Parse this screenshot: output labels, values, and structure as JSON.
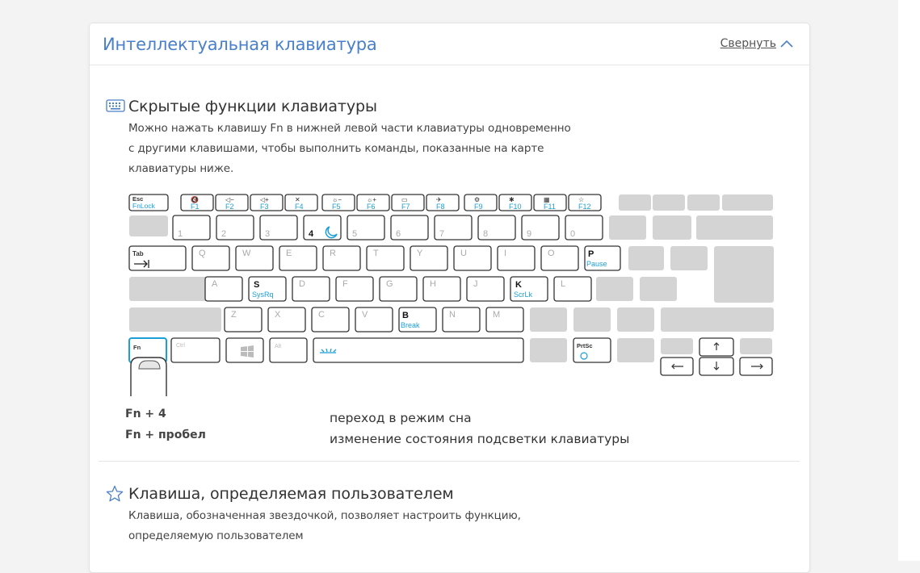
{
  "header": {
    "title": "Интеллектуальная клавиатура",
    "collapse_label": "Свернуть"
  },
  "hidden": {
    "title": "Скрытые функции клавиатуры",
    "desc": [
      "Можно нажать клавишу Fn в нижней левой части клавиатуры одновременно",
      "с другими клавишами, чтобы выполнить команды, показанные на карте",
      "клавиатуры ниже."
    ]
  },
  "keyboard": {
    "fkeys": [
      {
        "top": "Esc",
        "bot": "FnLock"
      },
      {
        "top": "🔇",
        "bot": "F1"
      },
      {
        "top": "◁−",
        "bot": "F2"
      },
      {
        "top": "◁+",
        "bot": "F3"
      },
      {
        "top": "✕",
        "bot": "F4"
      },
      {
        "top": "☼−",
        "bot": "F5"
      },
      {
        "top": "☼+",
        "bot": "F6"
      },
      {
        "top": "▭",
        "bot": "F7"
      },
      {
        "top": "✈",
        "bot": "F8"
      },
      {
        "top": "⚙",
        "bot": "F9"
      },
      {
        "top": "✱",
        "bot": "F10"
      },
      {
        "top": "▦",
        "bot": "F11"
      },
      {
        "top": "☆",
        "bot": "F12"
      }
    ],
    "num_row": [
      "1",
      "2",
      "3",
      "4",
      "5",
      "6",
      "7",
      "8",
      "9",
      "0"
    ],
    "top_row": [
      "Tab",
      "Q",
      "W",
      "E",
      "R",
      "T",
      "Y",
      "U",
      "I",
      "O",
      "P"
    ],
    "home_row": [
      "A",
      "S",
      "D",
      "F",
      "G",
      "H",
      "J",
      "K",
      "L"
    ],
    "low_row": [
      "Z",
      "X",
      "C",
      "V",
      "B",
      "N",
      "M"
    ],
    "bottom_row": [
      "Fn",
      "Ctrl",
      "Alt",
      "PrtSc"
    ],
    "highlights": {
      "p_sub": "Pause",
      "s_sub": "SysRq",
      "k_sub": "ScrLk",
      "b_sub": "Break"
    },
    "accent_color": "#1a9fd8"
  },
  "combos": [
    {
      "keys": "Fn + 4",
      "desc": "переход в режим сна"
    },
    {
      "keys": "Fn + пробел",
      "desc": "изменение состояния подсветки клавиатуры"
    }
  ],
  "user": {
    "title": "Клавиша, определяемая пользователем",
    "desc": [
      "Клавиша, обозначенная звездочкой, позволяет настроить функцию,",
      "определяемую пользователем"
    ]
  }
}
